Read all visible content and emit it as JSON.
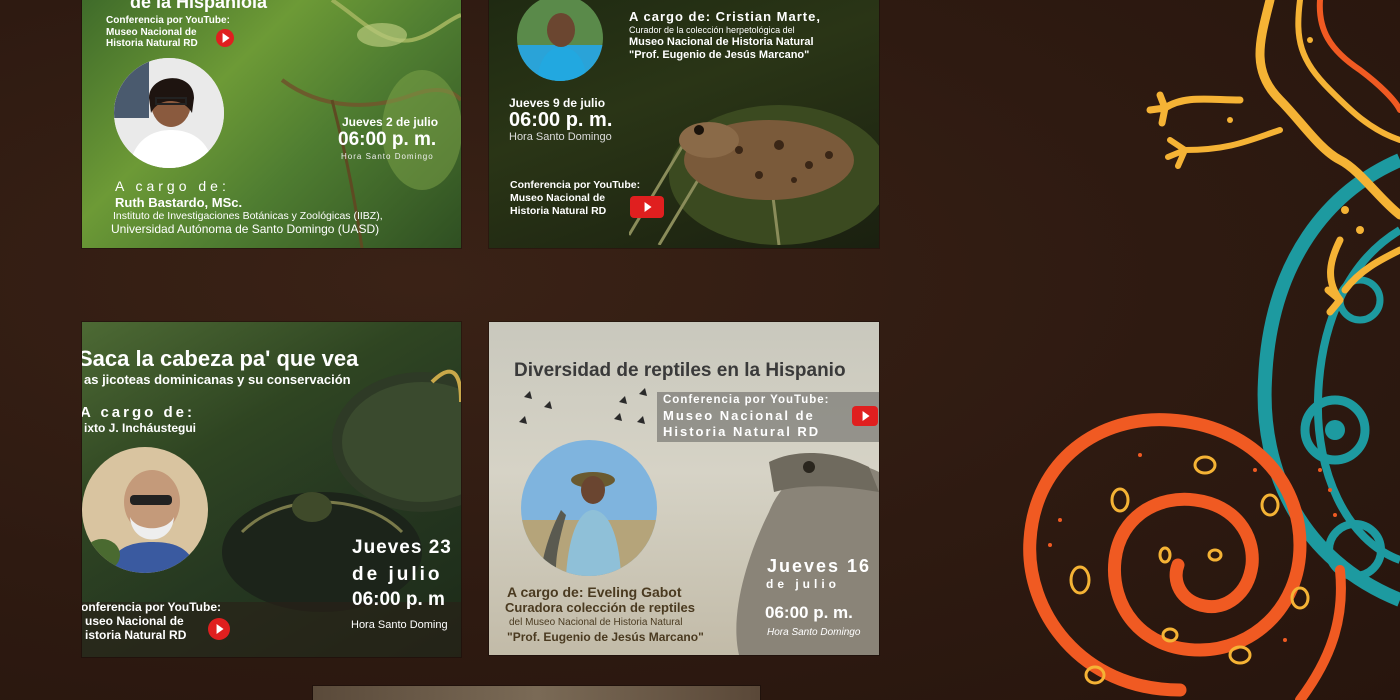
{
  "cards": [
    {
      "id": "card1",
      "heading": "de la Hispaniola",
      "yt_label_line1": "Conferencia por YouTube:",
      "yt_label_line2": "Museo Nacional de",
      "yt_label_line3": "Historia Natural RD",
      "date": "Jueves 2 de julio",
      "time": "06:00 p. m.",
      "tz": "Hora Santo Domingo",
      "acargo": "A cargo de:",
      "speaker": "Ruth Bastardo,  MSc.",
      "affil1": "Instituto de Investigaciones Botánicas y Zoológicas (IIBZ),",
      "affil2": "Universidad Autónoma de Santo Domingo (UASD)"
    },
    {
      "id": "card2",
      "acargo": "A cargo de: Cristian Marte,",
      "affil1": "Curador de la colección herpetológica del",
      "affil2": "Museo Nacional de Historia Natural",
      "affil3": "\"Prof. Eugenio de Jesús Marcano\"",
      "date": "Jueves 9 de julio",
      "time": "06:00 p. m.",
      "tz": "Hora Santo Domingo",
      "yt_label_line1": "Conferencia por YouTube:",
      "yt_label_line2": "Museo Nacional de",
      "yt_label_line3": "Historia Natural RD"
    },
    {
      "id": "card3",
      "title": "Saca la cabeza pa' que vea",
      "subtitle": "as jicoteas dominicanas y su conservación",
      "acargo": "A cargo de:",
      "speaker": "ixto J. Incháustegui",
      "date_line1": "Jueves 23",
      "date_line2": "de julio",
      "time": "06:00 p. m",
      "tz": "Hora Santo Doming",
      "yt_label_line1": "onferencia por YouTube:",
      "yt_label_line2": "useo Nacional de",
      "yt_label_line3": "istoria Natural RD"
    },
    {
      "id": "card4",
      "title": "Diversidad de reptiles en la Hispanio",
      "yt_label_line1": "Conferencia por YouTube:",
      "yt_label_line2": "Museo Nacional de",
      "yt_label_line3": "Historia Natural RD",
      "date_line1": "Jueves 16",
      "date_line2": "de julio",
      "time": "06:00 p. m.",
      "tz": "Hora Santo Domingo",
      "acargo": "A cargo de: Eveling Gabot",
      "affil1": "Curadora colección de reptiles",
      "affil2": "del Museo Nacional de Historia Natural",
      "affil3": "\"Prof. Eugenio de Jesús Marcano\""
    }
  ],
  "colors": {
    "page_bg": "#2e1a11",
    "accent_orange": "#f05a22",
    "accent_yellow": "#f5b335",
    "accent_teal": "#1d9aa0",
    "youtube_red": "#e01f1f"
  }
}
